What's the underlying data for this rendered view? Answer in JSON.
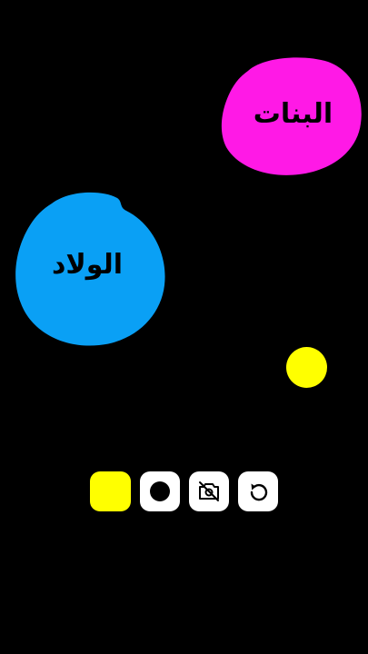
{
  "colors": {
    "background": "#000000",
    "girls_blob": "#ff19e6",
    "boys_blob": "#0aa0f5",
    "dot": "#ffff00",
    "button_bg": "#ffffff",
    "label_text": "#000000"
  },
  "blobs": {
    "girls": {
      "label": "البنات"
    },
    "boys": {
      "label": "الولاد"
    }
  },
  "toolbar": {
    "buttons": [
      {
        "name": "color-swatch",
        "icon": "yellow-square",
        "color": "#ffff00"
      },
      {
        "name": "brush-size",
        "icon": "filled-circle-icon"
      },
      {
        "name": "camera-off",
        "icon": "no-camera-icon"
      },
      {
        "name": "undo",
        "icon": "undo-arrow-icon"
      }
    ]
  }
}
